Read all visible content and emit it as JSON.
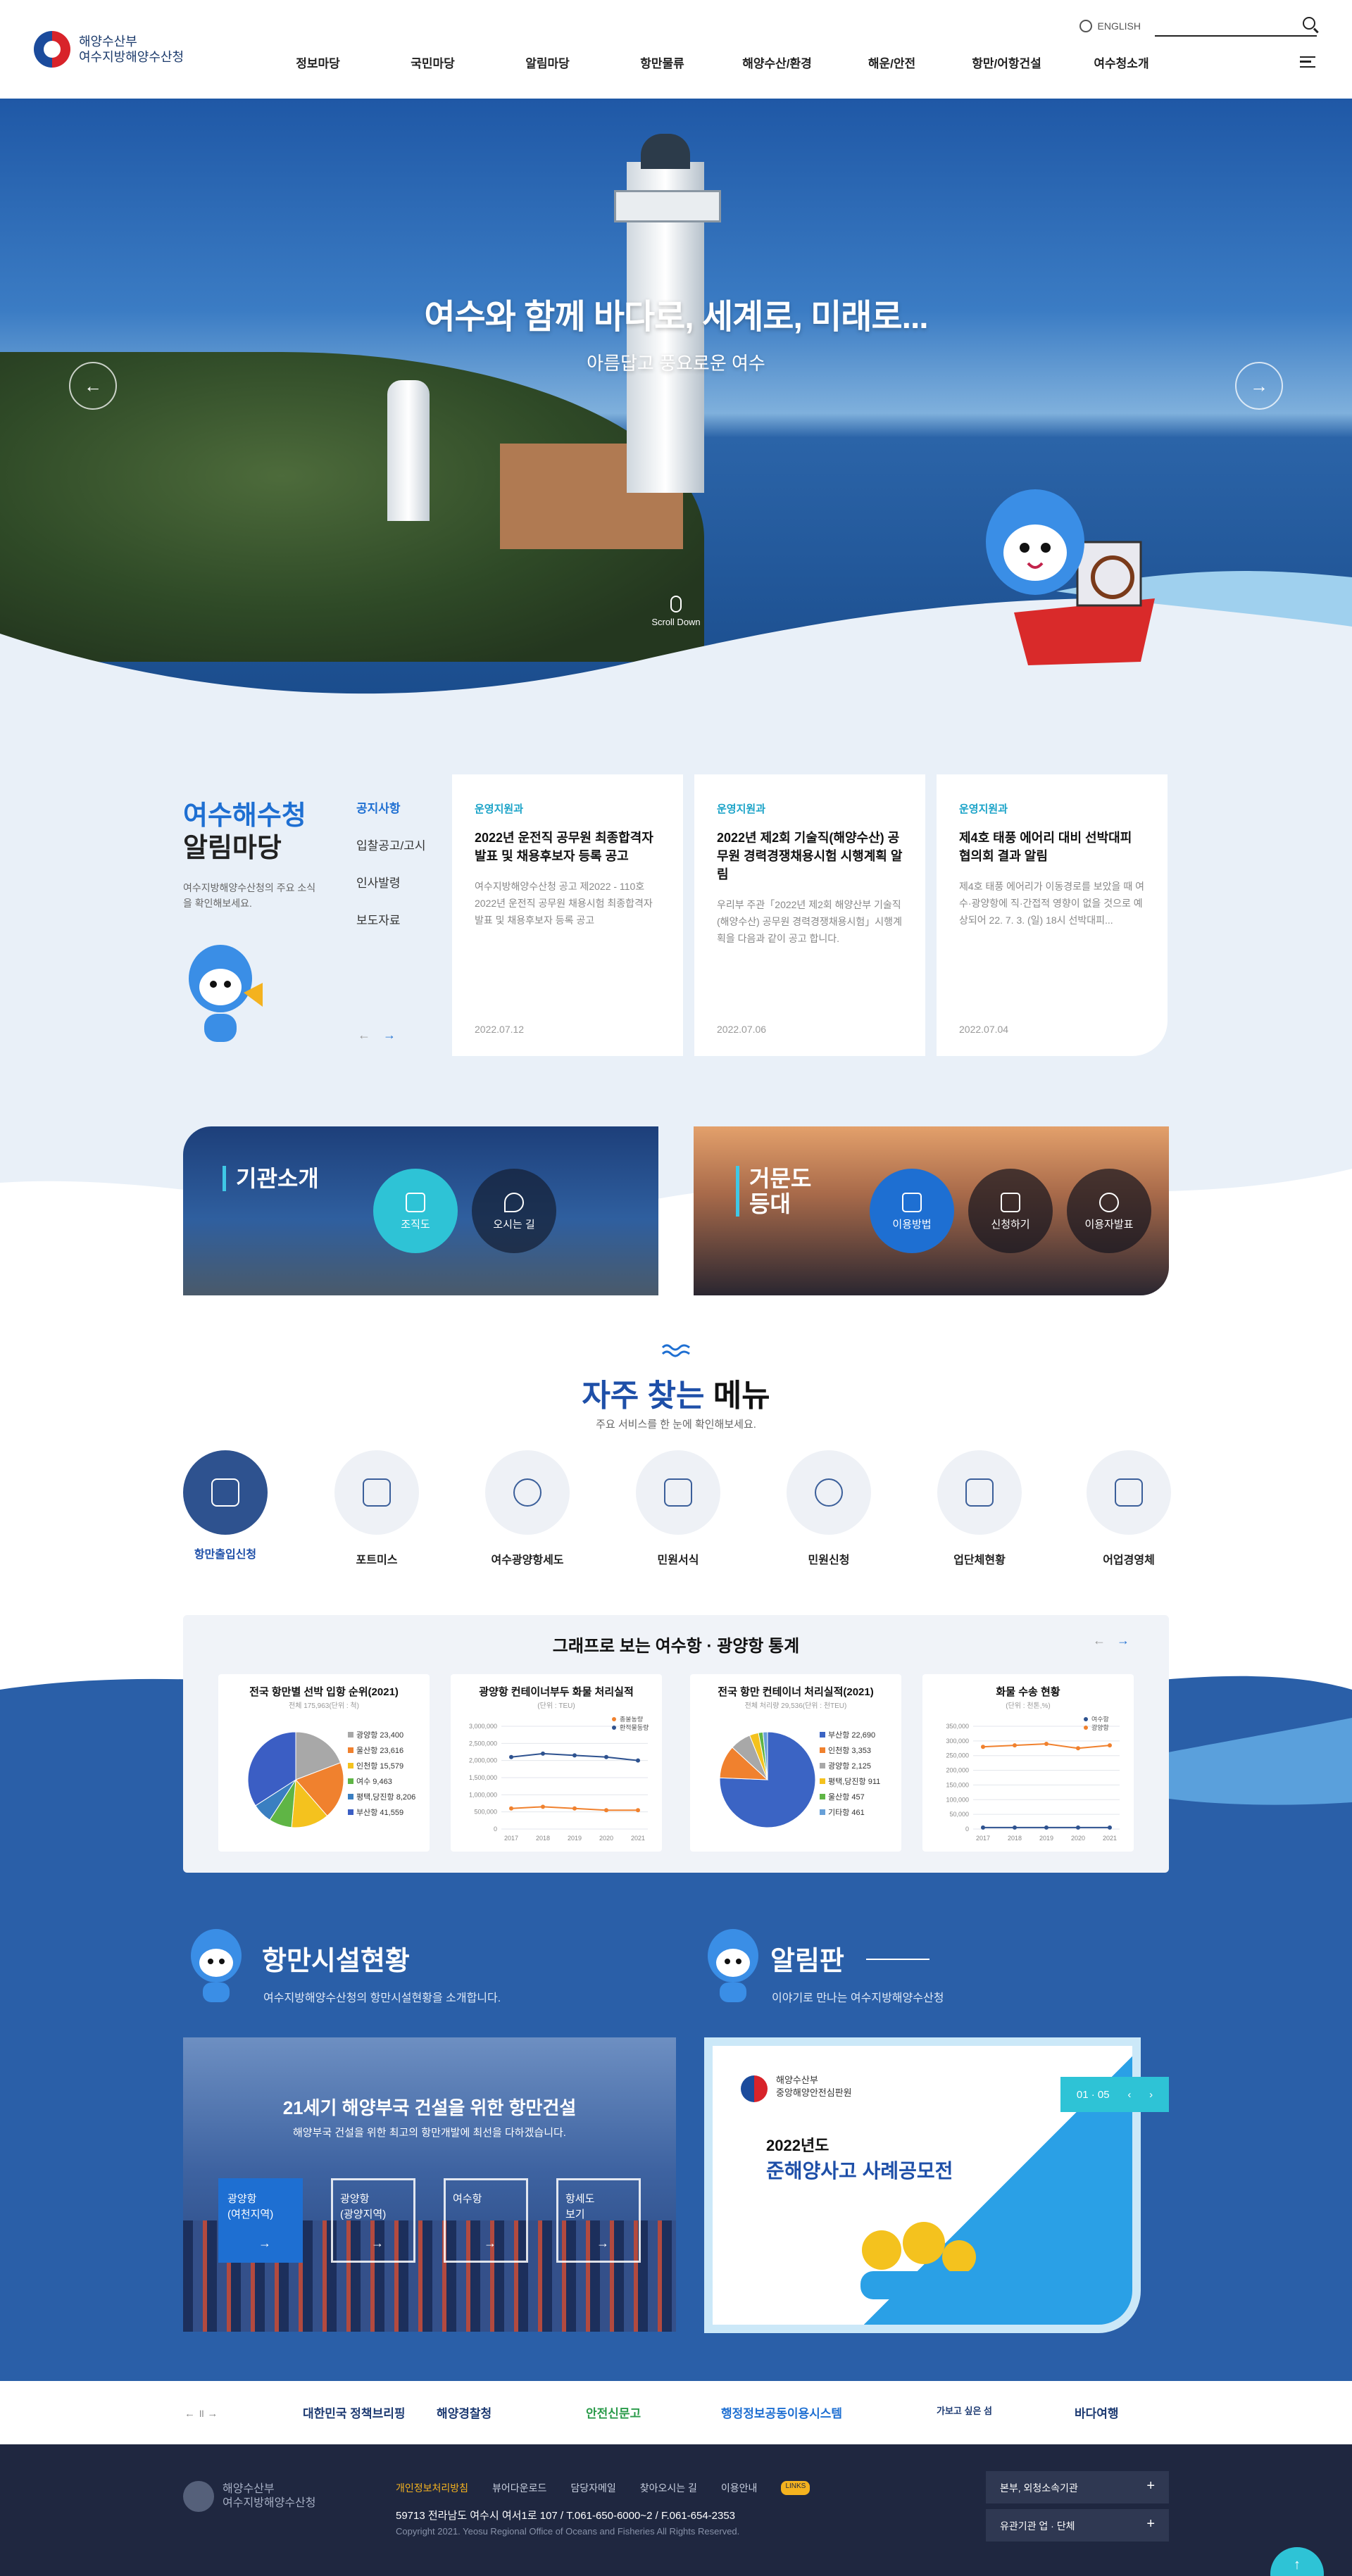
{
  "header": {
    "logo_line1": "해양수산부",
    "logo_line2": "여수지방해양수산청",
    "lang": "ENGLISH",
    "search_placeholder": "",
    "nav": [
      "정보마당",
      "국민마당",
      "알림마당",
      "항만물류",
      "해양수산/환경",
      "해운/안전",
      "항만/어항건설",
      "여수청소개"
    ]
  },
  "hero": {
    "title": "여수와 함께 바다로, 세계로, 미래로...",
    "subtitle": "아름답고 풍요로운 여수",
    "scroll_label": "Scroll Down",
    "prev": "←",
    "next": "→"
  },
  "notice": {
    "title_blue": "여수해수청",
    "title_dark": "알림마당",
    "desc": "여수지방해양수산청의 주요 소식을 확인해보세요.",
    "tabs": [
      "공지사항",
      "입찰공고/고시",
      "인사발령",
      "보도자료"
    ],
    "prev": "←",
    "next": "→",
    "cards": [
      {
        "category": "운영지원과",
        "title": "2022년 운전직 공무원 최종합격자 발표 및 채용후보자 등록 공고",
        "body": "여수지방해양수산청 공고 제2022 - 110호 2022년 운전직 공무원 채용시험 최종합격자 발표 및 채용후보자 등록 공고",
        "date": "2022.07.12"
      },
      {
        "category": "운영지원과",
        "title": "2022년 제2회 기술직(해양수산) 공무원 경력경쟁채용시험 시행계획 알림",
        "body": "우리부 주관「2022년 제2회 해양산부 기술직(해양수산) 공무원 경력경쟁채용시험」시행계획을 다음과 같이 공고 합니다.",
        "date": "2022.07.06"
      },
      {
        "category": "운영지원과",
        "title": "제4호 태풍 에어리 대비 선박대피 협의회 결과 알림",
        "body": "제4호 태풍 에어리가 이동경로를 보았을 때 여수·광양항에 직·간접적 영향이 없을 것으로 예상되어 22. 7. 3. (일) 18시 선박대피...",
        "date": "2022.07.04"
      }
    ]
  },
  "banners": {
    "org": {
      "title": "기관소개",
      "btn1": "조직도",
      "btn2": "오시는 길"
    },
    "light": {
      "title_line1": "거문도",
      "title_line2": "등대",
      "btn1": "이용방법",
      "btn2": "신청하기",
      "btn3": "이용자발표"
    }
  },
  "frequent": {
    "title_blue": "자주 찾는",
    "title_dark": "메뉴",
    "subtitle": "주요 서비스를 한 눈에 확인해보세요.",
    "items": [
      {
        "label": "항만출입신청",
        "icon": "ship-icon",
        "active": true
      },
      {
        "label": "포트미스",
        "icon": "monitor-icon"
      },
      {
        "label": "여수광양항세도",
        "icon": "compass-icon"
      },
      {
        "label": "민원서식",
        "icon": "document-icon"
      },
      {
        "label": "민원신청",
        "icon": "chat-icon"
      },
      {
        "label": "업단체현황",
        "icon": "people-icon"
      },
      {
        "label": "어업경영체",
        "icon": "building-icon"
      }
    ]
  },
  "stats": {
    "title": "그래프로 보는 여수항 · 광양항 통계",
    "prev": "←",
    "next": "→"
  },
  "chart_data": [
    {
      "type": "pie",
      "title": "전국 항만별 선박 입항 순위(2021)",
      "unit": "전체 175,963(단위 : 척)",
      "categories": [
        "광양항",
        "울산항",
        "인천항",
        "여수",
        "평택,당진항",
        "부산항"
      ],
      "values": [
        23400,
        23616,
        15579,
        9463,
        8206,
        41559
      ],
      "colors": [
        "#a8a8a8",
        "#f0812e",
        "#f4c21e",
        "#5fb545",
        "#3a7fc1",
        "#3b5ec4"
      ]
    },
    {
      "type": "line",
      "title": "광양항 컨테이너부두 화물 처리실적",
      "unit": "(단위 : TEU)",
      "x": [
        "2017",
        "2018",
        "2019",
        "2020",
        "2021"
      ],
      "ylim": [
        0,
        3000000
      ],
      "yticks": [
        "3,000,000",
        "2,500,000",
        "2,000,000",
        "1,500,000",
        "1,000,000",
        "500,000",
        "0"
      ],
      "series": [
        {
          "name": "총물동량",
          "color": "#f0812e",
          "values": [
            600000,
            650000,
            600000,
            550000,
            550000
          ]
        },
        {
          "name": "환적물동량",
          "color": "#2e528f",
          "values": [
            2100000,
            2200000,
            2150000,
            2100000,
            2000000
          ]
        }
      ]
    },
    {
      "type": "pie",
      "title": "전국 항만 컨테이너 처리실적(2021)",
      "unit": "전체 처리량 29,536(단위 : 천TEU)",
      "categories": [
        "부산항",
        "인천항",
        "광양항",
        "평택,당진항",
        "울산항",
        "기타항"
      ],
      "values": [
        22690,
        3353,
        2125,
        911,
        457,
        461
      ],
      "colors": [
        "#3b64c4",
        "#f0812e",
        "#a8a8a8",
        "#f4c21e",
        "#5fb545",
        "#68a0d8"
      ]
    },
    {
      "type": "line",
      "title": "화물 수송 현황",
      "unit": "(단위 : 천톤,%)",
      "x": [
        "2017",
        "2018",
        "2019",
        "2020",
        "2021"
      ],
      "ylim": [
        0,
        350000
      ],
      "yticks": [
        "350,000",
        "300,000",
        "250,000",
        "200,000",
        "150,000",
        "100,000",
        "50,000",
        "0"
      ],
      "series": [
        {
          "name": "여수항",
          "color": "#2e528f",
          "values": [
            5000,
            5000,
            5000,
            5000,
            5000
          ]
        },
        {
          "name": "광양항",
          "color": "#f0812e",
          "values": [
            280000,
            285000,
            290000,
            275000,
            285000
          ]
        }
      ]
    }
  ],
  "facility": {
    "title": "항만시설현황",
    "subtitle": "여수지방해양수산청의 항만시설현황을 소개합니다.",
    "box_title": "21세기 해양부국 건설을 위한 항만건설",
    "box_sub": "해양부국 건설을 위한 최고의 항만개발에 최선을 다하겠습니다.",
    "buttons": [
      {
        "line1": "광양항",
        "line2": "(여천지역)"
      },
      {
        "line1": "광양항",
        "line2": "(광양지역)"
      },
      {
        "line1": "여수항",
        "line2": ""
      },
      {
        "line1": "항세도",
        "line2": "보기"
      }
    ]
  },
  "board": {
    "title": "알림판",
    "subtitle": "이야기로 만나는 여수지방해양수산청",
    "pager": "01 · 05",
    "org_line1": "해양수산부",
    "org_line2": "중앙해양안전심판원",
    "year": "2022년도",
    "headline": "준해양사고 사례공모전"
  },
  "partners": {
    "nav": "← ॥ →",
    "logos": [
      "대한민국 정책브리핑",
      "해양경찰청",
      "안전신문고",
      "행정정보공동이용시스템",
      "가보고 싶은 섬",
      "바다여행"
    ]
  },
  "footer": {
    "logo_line1": "해양수산부",
    "logo_line2": "여수지방해양수산청",
    "links": [
      "개인정보처리방침",
      "뷰어다운로드",
      "담당자메일",
      "찾아오시는 길",
      "이용안내"
    ],
    "badge": "LINKS",
    "address": "59713 전라남도 여수시 여서1로 107 / T.061-650-6000~2 / F.061-654-2353",
    "copyright": "Copyright 2021. Yeosu Regional Office of Oceans and Fisheries All Rights Reserved.",
    "select1": "본부, 외청소속기관",
    "select2": "유관기관 업 · 단체",
    "top": "↑"
  }
}
